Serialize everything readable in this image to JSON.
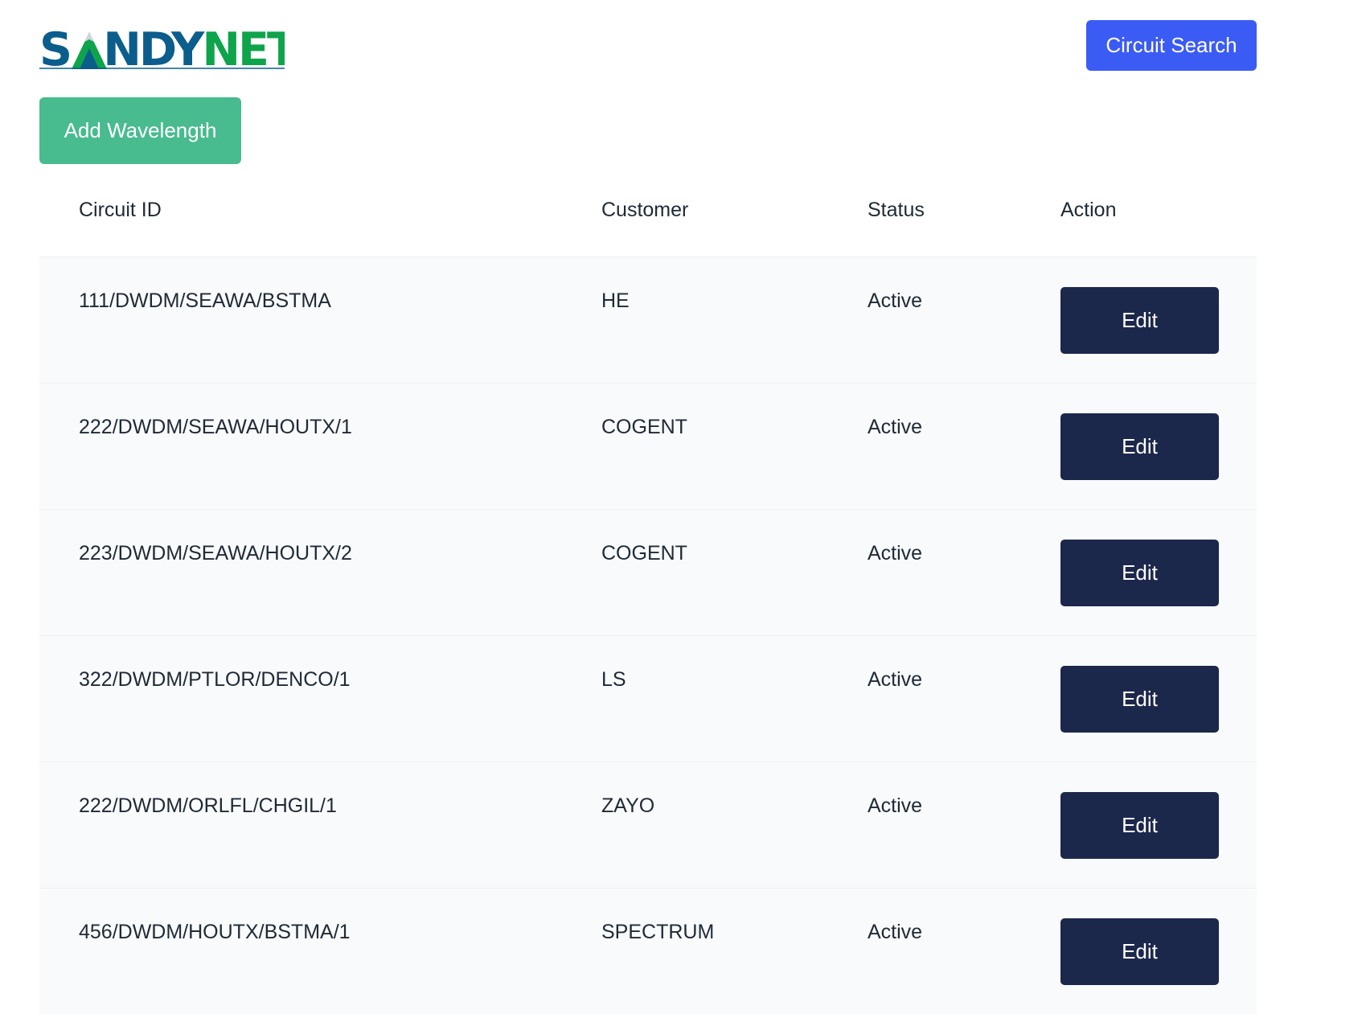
{
  "header": {
    "logo_text": "SANDYNET",
    "search_button_label": "Circuit Search"
  },
  "toolbar": {
    "add_button_label": "Add Wavelength"
  },
  "table": {
    "columns": [
      "Circuit ID",
      "Customer",
      "Status",
      "Action"
    ],
    "rows": [
      {
        "circuit_id": "111/DWDM/SEAWA/BSTMA",
        "customer": "HE",
        "status": "Active",
        "action": "Edit"
      },
      {
        "circuit_id": "222/DWDM/SEAWA/HOUTX/1",
        "customer": "COGENT",
        "status": "Active",
        "action": "Edit"
      },
      {
        "circuit_id": "223/DWDM/SEAWA/HOUTX/2",
        "customer": "COGENT",
        "status": "Active",
        "action": "Edit"
      },
      {
        "circuit_id": "322/DWDM/PTLOR/DENCO/1",
        "customer": "LS",
        "status": "Active",
        "action": "Edit"
      },
      {
        "circuit_id": "222/DWDM/ORLFL/CHGIL/1",
        "customer": "ZAYO",
        "status": "Active",
        "action": "Edit"
      },
      {
        "circuit_id": "456/DWDM/HOUTX/BSTMA/1",
        "customer": "SPECTRUM",
        "status": "Active",
        "action": "Edit"
      }
    ]
  },
  "colors": {
    "logo_blue": "#0b5d8c",
    "logo_green": "#0ea44b",
    "search_button": "#3b5bf5",
    "add_button": "#48bb8f",
    "edit_button": "#1c274c",
    "row_background": "#f9fafb"
  }
}
